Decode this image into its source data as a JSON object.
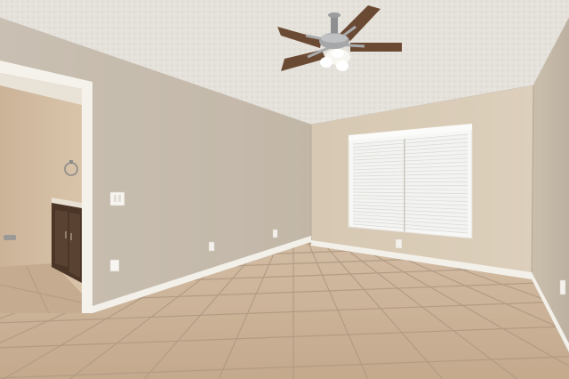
{
  "scene": {
    "type": "photo",
    "subject": "empty bedroom",
    "elements": [
      "vaulted-textured-ceiling",
      "ceiling-fan-with-light",
      "window-with-blinds",
      "bathroom-doorway",
      "vanity-cabinet",
      "towel-ring",
      "tile-floor",
      "baseboards",
      "outlets",
      "light-switch"
    ]
  },
  "colors": {
    "ceiling": "#e6e2dc",
    "wall_left": "#c6bbad",
    "wall_back": "#d8cbb6",
    "wall_right": "#c3b8a8",
    "floor": "#cdb49a",
    "grout": "#a8917a",
    "baseboard": "#f3f0ea",
    "fan_blade": "#6b4a33",
    "cabinet": "#4a3527"
  }
}
